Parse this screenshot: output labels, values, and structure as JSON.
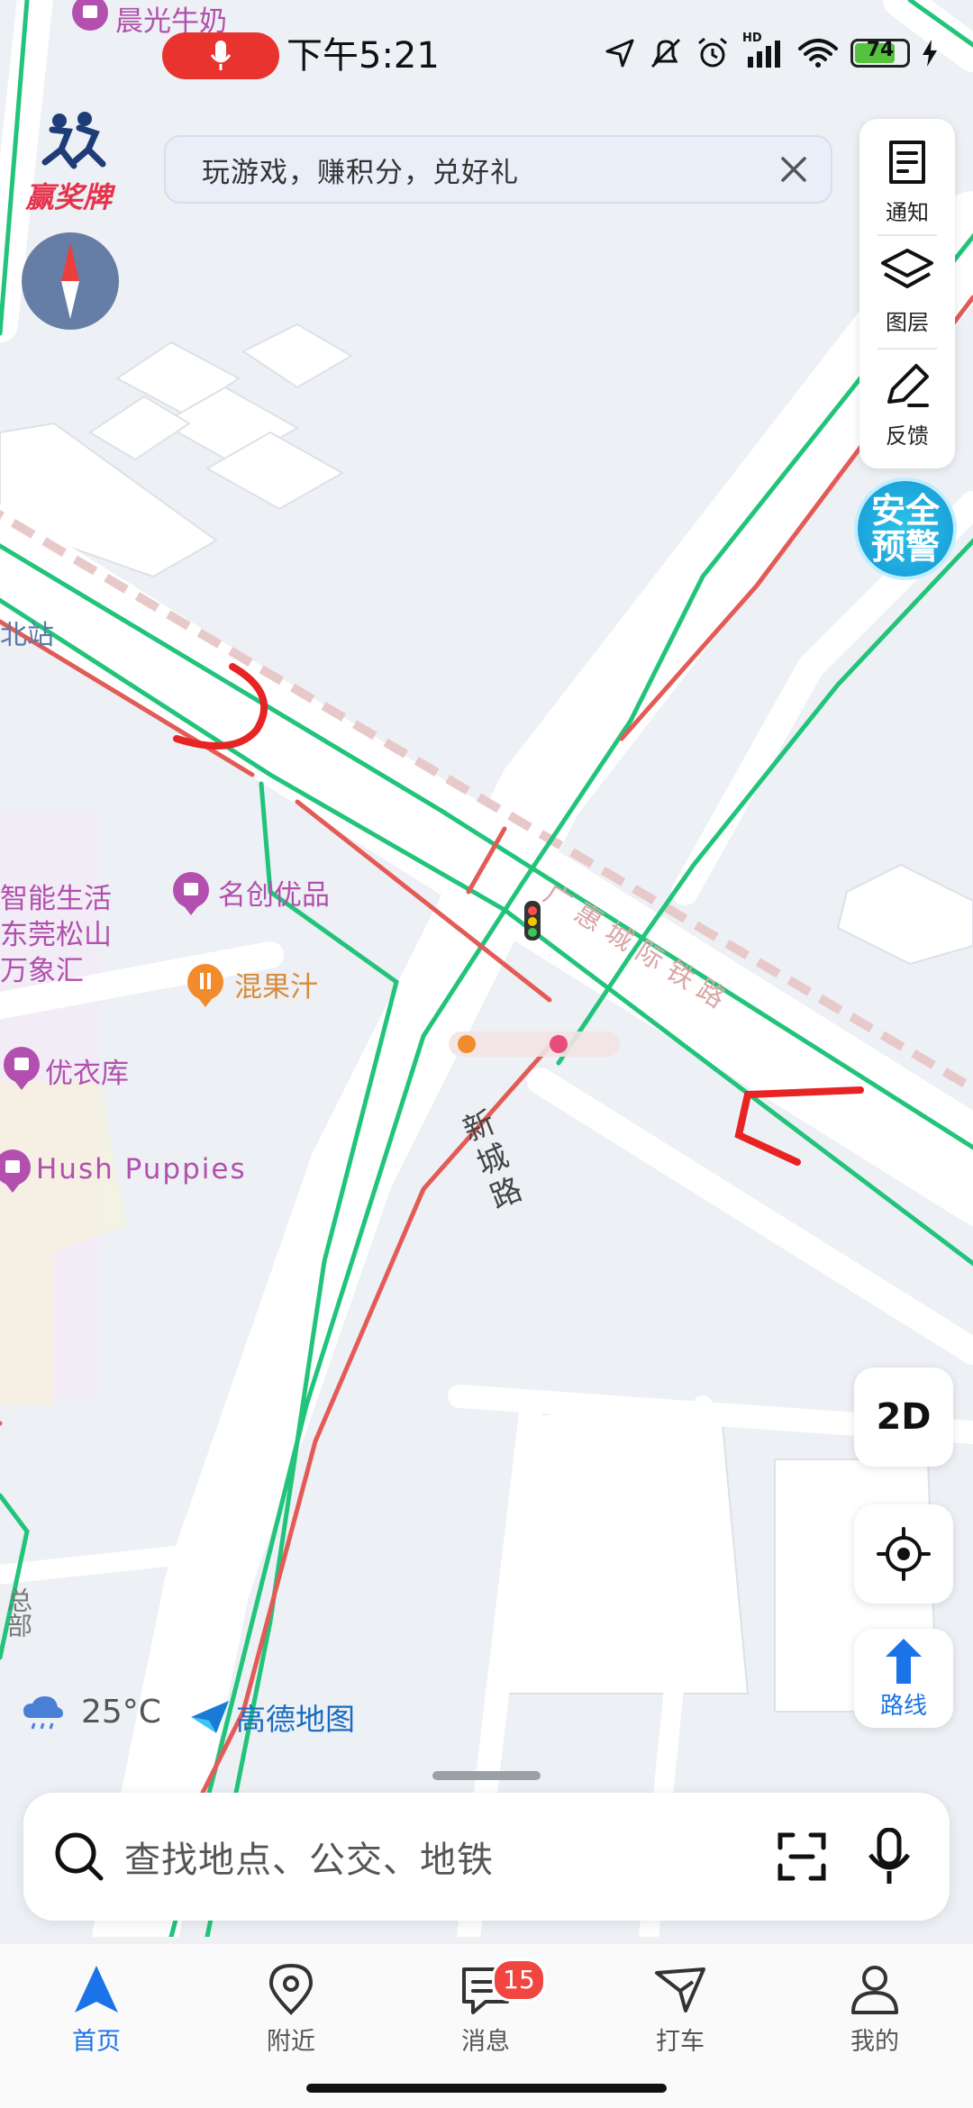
{
  "status_bar": {
    "time": "下午5:21",
    "battery": "74",
    "hd": "HD"
  },
  "banner": {
    "text": "玩游戏，赚积分，兑好礼"
  },
  "right_panel": {
    "notify": "通知",
    "layers": "图层",
    "feedback": "反馈"
  },
  "safety_badge": {
    "line1": "安全",
    "line2": "预警"
  },
  "logo_badge": "赢奖牌",
  "map_labels": {
    "poi_top": "晨光牛奶",
    "station": "北站",
    "railway": "广惠城际铁路",
    "road": "新城路",
    "shops": [
      "名创优品",
      "混果汁",
      "优衣库",
      "Hush Puppies"
    ],
    "mall_lines": [
      "智能生活",
      "东莞松山",
      "万象汇"
    ],
    "bottom_left": "总部"
  },
  "weather": {
    "temp": "25°C"
  },
  "brand": "高德地图",
  "controls": {
    "mode": "2D",
    "route": "路线"
  },
  "search": {
    "placeholder": "查找地点、公交、地铁"
  },
  "nav": [
    {
      "label": "首页"
    },
    {
      "label": "附近"
    },
    {
      "label": "消息",
      "badge": "15"
    },
    {
      "label": "打车"
    },
    {
      "label": "我的"
    }
  ],
  "colors": {
    "accent": "#1a73e8",
    "traffic_green": "#21c47a",
    "traffic_red": "#e35b56",
    "poi": "#b34fae"
  }
}
